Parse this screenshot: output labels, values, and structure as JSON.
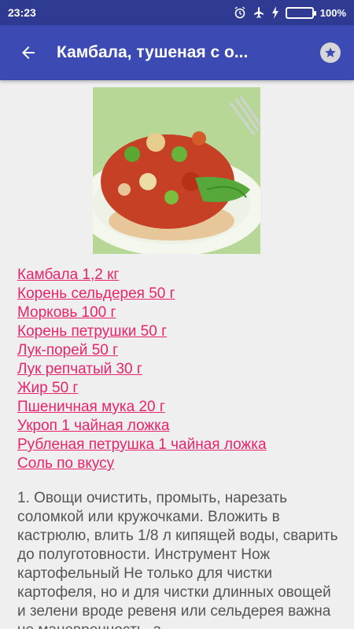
{
  "status_bar": {
    "time": "23:23",
    "battery_percent": "100%",
    "icons": [
      "alarm-icon",
      "airplane-mode-icon",
      "charging-bolt-icon",
      "battery-icon"
    ]
  },
  "app_bar": {
    "title": "Камбала, тушеная с о...",
    "back_icon": "arrow-back-icon",
    "favorite_icon": "star-icon"
  },
  "colors": {
    "status_bar": "#2f3a93",
    "app_bar": "#3b4bb3",
    "link": "#e8246c",
    "text": "#555555",
    "background": "#efefef"
  },
  "ingredients": [
    "Камбала 1,2 кг",
    "Корень сельдерея 50 г",
    "Морковь 100 г",
    "Корень петрушки 50 г",
    "Лук-порей 50 г",
    "Лук репчатый 30 г",
    "Жир 50 г",
    "Пшеничная мука 20 г",
    "Укроп 1 чайная ложка",
    "Рубленая петрушка 1 чайная ложка",
    "Соль по вкусу"
  ],
  "instructions": "1. Овощи очистить, промыть, нарезать соломкой или кружочками. Вложить в кастрюлю, влить 1/8 л кипящей воды, сварить до полуготовности. Инструмент Нож картофельный Не только для чистки картофеля, но и для чистки длинных овощей и зелени вроде ревеня или сельдерея важна не маневренность, а"
}
